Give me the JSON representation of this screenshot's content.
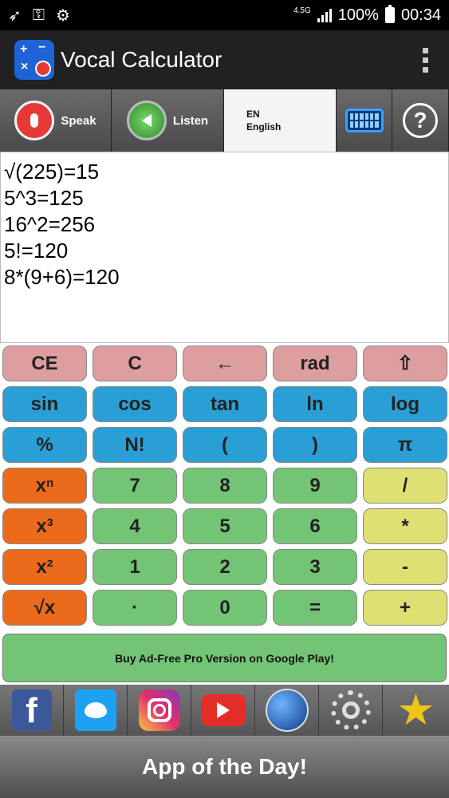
{
  "status_bar": {
    "network": "4.5G",
    "battery": "100%",
    "time": "00:34"
  },
  "app_bar": {
    "title": "Vocal Calculator"
  },
  "toolbar": {
    "speak_label": "Speak",
    "listen_label": "Listen",
    "lang_code": "EN",
    "lang_name": "English"
  },
  "display": {
    "lines": [
      "√(225)=15",
      "5^3=125",
      "16^2=256",
      "5!=120",
      "8*(9+6)=120"
    ]
  },
  "keypad": {
    "rows": [
      [
        {
          "label": "CE",
          "color": "#dd9ea0"
        },
        {
          "label": "C",
          "color": "#dd9ea0"
        },
        {
          "label": "←",
          "color": "#dd9ea0"
        },
        {
          "label": "rad",
          "color": "#dd9ea0"
        },
        {
          "label": "⇧",
          "color": "#dd9ea0"
        }
      ],
      [
        {
          "label": "sin",
          "color": "#2a9fd6"
        },
        {
          "label": "cos",
          "color": "#2a9fd6"
        },
        {
          "label": "tan",
          "color": "#2a9fd6"
        },
        {
          "label": "ln",
          "color": "#2a9fd6"
        },
        {
          "label": "log",
          "color": "#2a9fd6"
        }
      ],
      [
        {
          "label": "%",
          "color": "#2a9fd6"
        },
        {
          "label": "N!",
          "color": "#2a9fd6"
        },
        {
          "label": "(",
          "color": "#2a9fd6"
        },
        {
          "label": ")",
          "color": "#2a9fd6"
        },
        {
          "label": "π",
          "color": "#2a9fd6"
        }
      ],
      [
        {
          "label": "xⁿ",
          "color": "#ec6a1b"
        },
        {
          "label": "7",
          "color": "#74c476"
        },
        {
          "label": "8",
          "color": "#74c476"
        },
        {
          "label": "9",
          "color": "#74c476"
        },
        {
          "label": "/",
          "color": "#dfe073"
        }
      ],
      [
        {
          "label": "x³",
          "color": "#ec6a1b"
        },
        {
          "label": "4",
          "color": "#74c476"
        },
        {
          "label": "5",
          "color": "#74c476"
        },
        {
          "label": "6",
          "color": "#74c476"
        },
        {
          "label": "*",
          "color": "#dfe073"
        }
      ],
      [
        {
          "label": "x²",
          "color": "#ec6a1b"
        },
        {
          "label": "1",
          "color": "#74c476"
        },
        {
          "label": "2",
          "color": "#74c476"
        },
        {
          "label": "3",
          "color": "#74c476"
        },
        {
          "label": "-",
          "color": "#dfe073"
        }
      ],
      [
        {
          "label": "√x",
          "color": "#ec6a1b"
        },
        {
          "label": "·",
          "color": "#74c476"
        },
        {
          "label": "0",
          "color": "#74c476"
        },
        {
          "label": "=",
          "color": "#74c476"
        },
        {
          "label": "+",
          "color": "#dfe073"
        }
      ]
    ],
    "promo_label": "Buy Ad-Free Pro Version on Google Play!"
  },
  "social_bar": {
    "icons": [
      "facebook-icon",
      "twitter-icon",
      "instagram-icon",
      "youtube-icon",
      "website-icon",
      "settings-icon",
      "rate-star-icon"
    ],
    "facebook_glyph": "f",
    "star_glyph": "★"
  },
  "app_of_the_day": {
    "label": "App of the Day!"
  }
}
